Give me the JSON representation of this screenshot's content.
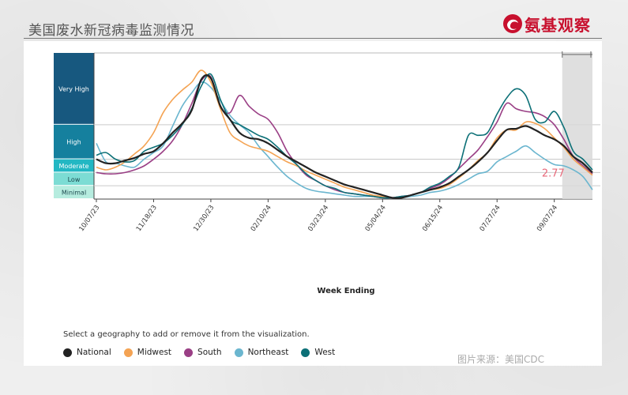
{
  "header": {
    "title": "美国废水新冠病毒监测情况",
    "brand": "氨基观察"
  },
  "source": "图片来源：美国CDC",
  "legend_prompt": "Select a geography to add or remove it from the visualization.",
  "colors": {
    "national": "#222222",
    "midwest": "#f4a353",
    "south": "#9a3f85",
    "northeast": "#6bb6cf",
    "west": "#0c7077",
    "band_very_high": "#17587f",
    "band_high": "#15809e",
    "band_moderate": "#22b7c3",
    "band_low": "#7cdcd4",
    "band_minimal": "#b6ecdf",
    "annotation": "#e8697a",
    "brand": "#c8102e"
  },
  "chart_data": {
    "type": "line",
    "xlabel": "Week Ending",
    "x_ticks": [
      "10/07/23",
      "11/18/23",
      "12/30/23",
      "02/10/24",
      "03/23/24",
      "05/04/24",
      "06/15/24",
      "07/27/24",
      "09/07/24"
    ],
    "ylim": [
      0,
      11
    ],
    "levels": [
      {
        "name": "Very High",
        "from": 5.6,
        "to": 11
      },
      {
        "name": "High",
        "from": 3.0,
        "to": 5.6
      },
      {
        "name": "Moderate",
        "from": 2.0,
        "to": 3.0
      },
      {
        "name": "Low",
        "from": 1.0,
        "to": 2.0
      },
      {
        "name": "Minimal",
        "from": 0,
        "to": 1.0
      }
    ],
    "annotation": {
      "text": "2.77",
      "week": 50,
      "value": 2.77
    },
    "shaded_weeks": [
      49,
      52
    ],
    "series": [
      {
        "name": "National",
        "key": "national",
        "weeks": [
          0,
          1,
          2,
          3,
          4,
          5,
          6,
          7,
          8,
          9,
          10,
          11,
          12,
          13,
          14,
          15,
          16,
          17,
          18,
          19,
          20,
          21,
          22,
          23,
          24,
          25,
          26,
          27,
          28,
          29,
          30,
          31,
          32,
          33,
          34,
          35,
          36,
          37,
          38,
          39,
          40,
          41,
          42,
          43,
          44,
          45,
          46,
          47,
          48,
          49,
          50,
          51,
          52
        ],
        "values": [
          3.0,
          2.7,
          2.7,
          2.9,
          3.1,
          3.4,
          3.6,
          4.2,
          5.0,
          5.7,
          6.7,
          9.0,
          9.1,
          7.0,
          6.0,
          5.0,
          4.6,
          4.5,
          4.2,
          3.7,
          3.2,
          2.8,
          2.4,
          2.0,
          1.7,
          1.4,
          1.1,
          0.9,
          0.7,
          0.5,
          0.3,
          0.1,
          0.1,
          0.3,
          0.5,
          0.7,
          0.9,
          1.2,
          1.7,
          2.2,
          2.8,
          3.5,
          4.4,
          5.2,
          5.3,
          5.5,
          5.2,
          4.8,
          4.5,
          4.0,
          3.2,
          2.7,
          2.0
        ]
      },
      {
        "name": "Midwest",
        "key": "midwest",
        "weeks": [
          0,
          1,
          2,
          3,
          4,
          5,
          6,
          7,
          8,
          9,
          10,
          11,
          12,
          13,
          14,
          15,
          16,
          17,
          18,
          19,
          20,
          21,
          22,
          23,
          24,
          25,
          26,
          27,
          28,
          29,
          30,
          31,
          32,
          33,
          34,
          35,
          36,
          37,
          38,
          39,
          40,
          41,
          42,
          43,
          44,
          45,
          46,
          47,
          48,
          49,
          50,
          51,
          52
        ],
        "values": [
          2.4,
          2.2,
          2.4,
          2.8,
          3.4,
          4.0,
          5.0,
          6.5,
          7.5,
          8.2,
          8.8,
          9.7,
          8.8,
          6.8,
          5.0,
          4.4,
          4.0,
          3.8,
          3.6,
          3.2,
          2.8,
          2.5,
          2.1,
          1.8,
          1.5,
          1.2,
          0.9,
          0.7,
          0.5,
          0.3,
          0.2,
          0.1,
          0.1,
          0.3,
          0.5,
          0.7,
          0.8,
          1.1,
          1.6,
          2.2,
          2.9,
          3.5,
          4.6,
          5.2,
          5.2,
          5.8,
          5.7,
          5.3,
          4.6,
          3.9,
          3.0,
          2.4,
          1.8
        ]
      },
      {
        "name": "South",
        "key": "south",
        "weeks": [
          0,
          1,
          2,
          3,
          4,
          5,
          6,
          7,
          8,
          9,
          10,
          11,
          12,
          13,
          14,
          15,
          16,
          17,
          18,
          19,
          20,
          21,
          22,
          23,
          24,
          25,
          26,
          27,
          28,
          29,
          30,
          31,
          32,
          33,
          34,
          35,
          36,
          37,
          38,
          39,
          40,
          41,
          42,
          43,
          44,
          45,
          46,
          47,
          48,
          49,
          50,
          51,
          52
        ],
        "values": [
          2.0,
          1.9,
          1.9,
          2.0,
          2.2,
          2.5,
          3.0,
          3.6,
          4.4,
          5.6,
          7.2,
          8.9,
          9.2,
          7.0,
          6.5,
          7.8,
          7.0,
          6.4,
          6.0,
          5.0,
          3.6,
          2.6,
          1.8,
          1.4,
          1.0,
          0.7,
          0.5,
          0.4,
          0.3,
          0.2,
          0.1,
          0.1,
          0.2,
          0.3,
          0.5,
          0.8,
          1.1,
          1.6,
          2.3,
          3.0,
          3.7,
          4.7,
          5.8,
          7.2,
          6.8,
          6.6,
          6.5,
          6.2,
          5.6,
          4.5,
          3.2,
          2.5,
          1.9
        ]
      },
      {
        "name": "Northeast",
        "key": "northeast",
        "weeks": [
          0,
          1,
          2,
          3,
          4,
          5,
          6,
          7,
          8,
          9,
          10,
          11,
          12,
          13,
          14,
          15,
          16,
          17,
          18,
          19,
          20,
          21,
          22,
          23,
          24,
          25,
          26,
          27,
          28,
          29,
          30,
          31,
          32,
          33,
          34,
          35,
          36,
          37,
          38,
          39,
          40,
          41,
          42,
          43,
          44,
          45,
          46,
          47,
          48,
          49,
          50,
          51,
          52
        ],
        "values": [
          4.2,
          2.8,
          2.7,
          2.5,
          2.4,
          3.0,
          3.5,
          4.0,
          5.5,
          7.0,
          8.0,
          8.8,
          8.4,
          7.4,
          6.3,
          5.6,
          5.0,
          4.0,
          3.2,
          2.4,
          1.7,
          1.2,
          0.8,
          0.6,
          0.5,
          0.4,
          0.3,
          0.2,
          0.2,
          0.2,
          0.2,
          0.1,
          0.1,
          0.2,
          0.3,
          0.5,
          0.6,
          0.8,
          1.1,
          1.5,
          1.9,
          2.1,
          2.8,
          3.2,
          3.6,
          4.0,
          3.5,
          3.0,
          2.6,
          2.5,
          2.2,
          1.7,
          0.7
        ]
      },
      {
        "name": "West",
        "key": "west",
        "weeks": [
          0,
          1,
          2,
          3,
          4,
          5,
          6,
          7,
          8,
          9,
          10,
          11,
          12,
          13,
          14,
          15,
          16,
          17,
          18,
          19,
          20,
          21,
          22,
          23,
          24,
          25,
          26,
          27,
          28,
          29,
          30,
          31,
          32,
          33,
          34,
          35,
          36,
          37,
          38,
          39,
          40,
          41,
          42,
          43,
          44,
          45,
          46,
          47,
          48,
          49,
          50,
          51,
          52
        ],
        "values": [
          3.3,
          3.5,
          3.0,
          2.8,
          2.9,
          3.6,
          3.9,
          4.2,
          4.8,
          5.6,
          6.8,
          8.5,
          9.4,
          7.5,
          6.0,
          5.6,
          5.2,
          4.8,
          4.5,
          3.9,
          3.2,
          2.6,
          1.9,
          1.4,
          1.0,
          0.8,
          0.5,
          0.4,
          0.3,
          0.2,
          0.1,
          0.1,
          0.2,
          0.3,
          0.5,
          0.9,
          1.2,
          1.7,
          2.4,
          4.8,
          4.8,
          5.0,
          6.4,
          7.6,
          8.3,
          7.8,
          6.0,
          5.8,
          6.6,
          5.4,
          3.6,
          3.0,
          2.2
        ]
      }
    ]
  }
}
